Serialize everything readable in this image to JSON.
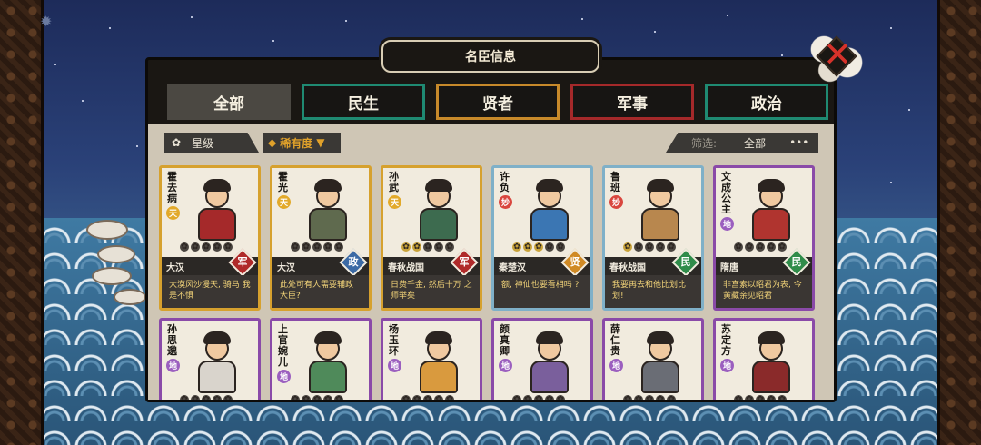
{
  "colors": {
    "tab_minsheng": "#1f8a72",
    "tab_xianzhe": "#c7892a",
    "tab_junshi": "#a5292a",
    "tab_zhengzhi": "#1f8a72",
    "border_tian": "#d6a12e",
    "border_miao": "#7fb0c8",
    "border_di": "#8a4aa8",
    "tier_tian": "#e2a92a",
    "tier_miao": "#d9463e",
    "tier_di": "#9b5fbf",
    "cat_jun": "#b02a2a",
    "cat_zheng": "#3b6aa5",
    "cat_xian": "#d08a25",
    "cat_min": "#2f8c4a"
  },
  "header": {
    "title": "名臣信息",
    "close_icon": "close-x-icon"
  },
  "tabs": [
    {
      "label": "全部",
      "active": true
    },
    {
      "label": "民生",
      "active": false
    },
    {
      "label": "贤者",
      "active": false
    },
    {
      "label": "军事",
      "active": false
    },
    {
      "label": "政治",
      "active": false
    }
  ],
  "filterbar": {
    "grade_label": "星级",
    "rarity_label": "稀有度",
    "filter_label": "筛选:",
    "filter_value": "全部",
    "more_label": "•••"
  },
  "cards": [
    {
      "name": "霍去病",
      "tier": "天",
      "tier_type": "tian",
      "stars_on": 0,
      "era": "大汉",
      "category": "军",
      "cat_type": "jun",
      "quote": "大漠风沙漫天, 骑马 我是不惧",
      "robe": "#a5292a"
    },
    {
      "name": "霍光",
      "tier": "天",
      "tier_type": "tian",
      "stars_on": 0,
      "era": "大汉",
      "category": "政",
      "cat_type": "zheng",
      "quote": "此处可有人需要辅政 大臣?",
      "robe": "#5f6a4e"
    },
    {
      "name": "孙武",
      "tier": "天",
      "tier_type": "tian",
      "stars_on": 2,
      "era": "春秋战国",
      "category": "军",
      "cat_type": "jun",
      "quote": "日费千金, 然后十万 之师举矣",
      "robe": "#3d6b4f"
    },
    {
      "name": "许负",
      "tier": "妙",
      "tier_type": "miao",
      "stars_on": 3,
      "era": "秦楚汉",
      "category": "贤",
      "cat_type": "xian",
      "quote": "额, 神仙也要看相吗 ?",
      "robe": "#3b76b3"
    },
    {
      "name": "鲁班",
      "tier": "妙",
      "tier_type": "miao",
      "stars_on": 1,
      "era": "春秋战国",
      "category": "民",
      "cat_type": "min",
      "quote": "我要再去和他比划比 划!",
      "robe": "#b8874e"
    },
    {
      "name": "文成公主",
      "tier": "地",
      "tier_type": "di",
      "stars_on": 0,
      "era": "隋唐",
      "category": "民",
      "cat_type": "min",
      "quote": "非宫素以昭君为表, 今黄藏亲见昭君",
      "robe": "#b0342f"
    },
    {
      "name": "孙思邈",
      "tier": "地",
      "tier_type": "di",
      "stars_on": 0,
      "era": "",
      "category": "",
      "cat_type": "",
      "quote": "",
      "robe": "#d9d4cc"
    },
    {
      "name": "上官婉儿",
      "tier": "地",
      "tier_type": "di",
      "stars_on": 0,
      "era": "",
      "category": "",
      "cat_type": "",
      "quote": "",
      "robe": "#4f8a5a"
    },
    {
      "name": "杨玉环",
      "tier": "地",
      "tier_type": "di",
      "stars_on": 0,
      "era": "",
      "category": "",
      "cat_type": "",
      "quote": "",
      "robe": "#d99a3e"
    },
    {
      "name": "颜真卿",
      "tier": "地",
      "tier_type": "di",
      "stars_on": 0,
      "era": "",
      "category": "",
      "cat_type": "",
      "quote": "",
      "robe": "#7a5f9c"
    },
    {
      "name": "薛仁贵",
      "tier": "地",
      "tier_type": "di",
      "stars_on": 0,
      "era": "",
      "category": "",
      "cat_type": "",
      "quote": "",
      "robe": "#6a6d75"
    },
    {
      "name": "苏定方",
      "tier": "地",
      "tier_type": "di",
      "stars_on": 0,
      "era": "",
      "category": "",
      "cat_type": "",
      "quote": "",
      "robe": "#8a2a2a"
    }
  ]
}
